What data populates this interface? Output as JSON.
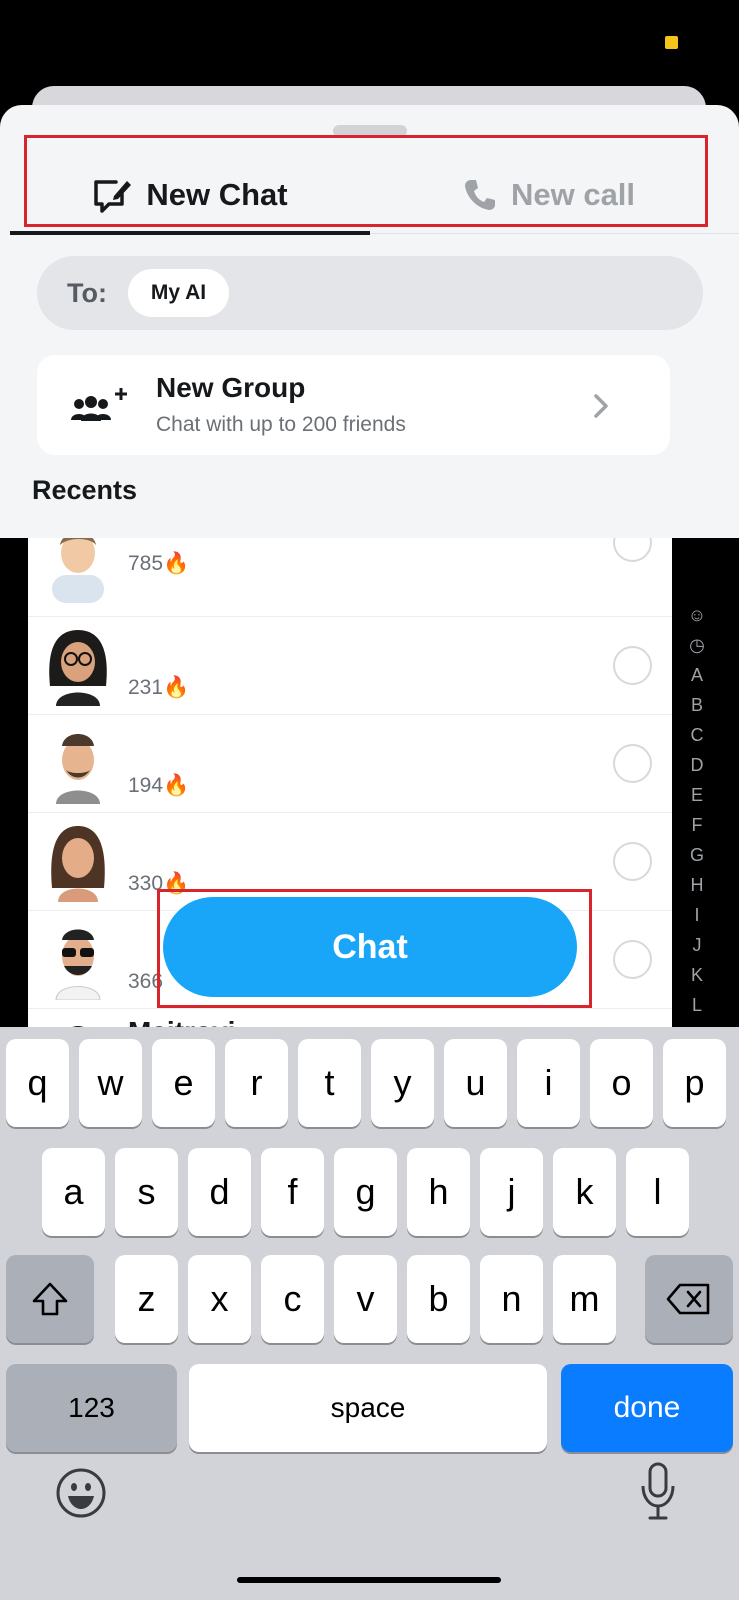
{
  "tabs": {
    "new_chat": "New Chat",
    "new_call": "New call"
  },
  "to_field": {
    "label": "To:",
    "recipient": "My AI"
  },
  "new_group": {
    "title": "New Group",
    "subtitle": "Chat with up to 200 friends"
  },
  "recents": {
    "title": "Recents",
    "rows": [
      {
        "score": "785",
        "emoji": "🔥"
      },
      {
        "score": "231",
        "emoji": "🔥"
      },
      {
        "score": "194",
        "emoji": "🔥"
      },
      {
        "score": "330",
        "emoji": "🔥"
      },
      {
        "score": "366",
        "emoji": ""
      },
      {
        "score": "",
        "name_partial": "Maitroyi"
      }
    ]
  },
  "alphabet_index": [
    "☺",
    "◷",
    "A",
    "B",
    "C",
    "D",
    "E",
    "F",
    "G",
    "H",
    "I",
    "J",
    "K",
    "L"
  ],
  "chat_button": "Chat",
  "keyboard": {
    "row1": [
      "q",
      "w",
      "e",
      "r",
      "t",
      "y",
      "u",
      "i",
      "o",
      "p"
    ],
    "row2": [
      "a",
      "s",
      "d",
      "f",
      "g",
      "h",
      "j",
      "k",
      "l"
    ],
    "row3": [
      "z",
      "x",
      "c",
      "v",
      "b",
      "n",
      "m"
    ],
    "numbers": "123",
    "space": "space",
    "done": "done"
  },
  "colors": {
    "accent": "#1aa6f8",
    "highlight_box": "#d8242c",
    "done_key": "#0a7cff"
  }
}
